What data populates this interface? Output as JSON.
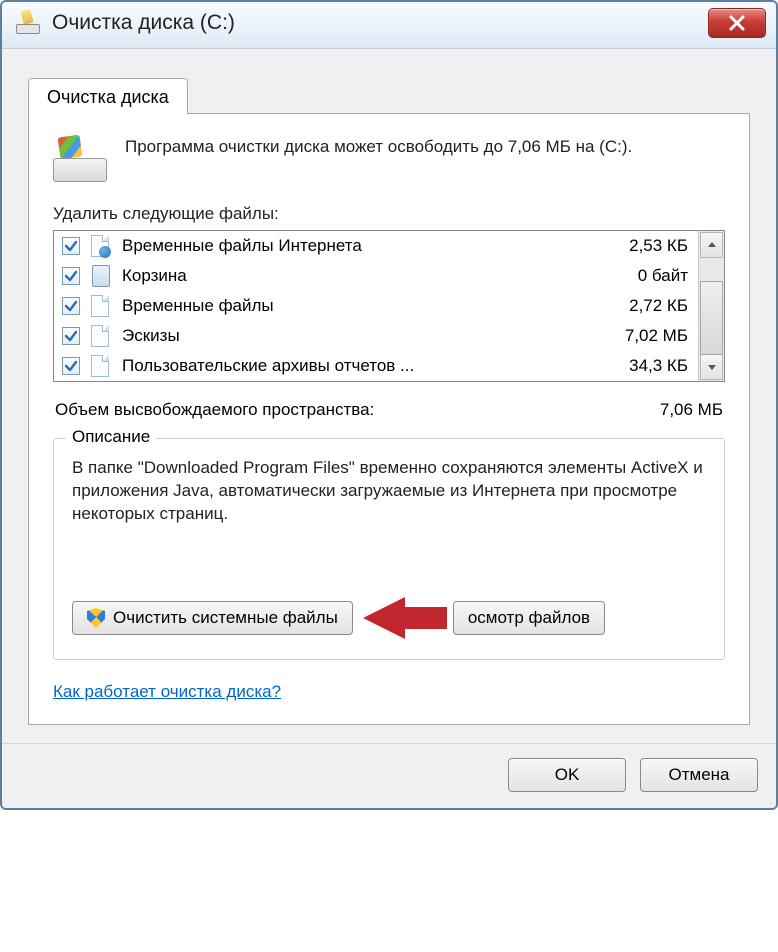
{
  "window": {
    "title": "Очистка диска  (C:)"
  },
  "tab": {
    "label": "Очистка диска"
  },
  "intro": {
    "text": "Программа очистки диска может освободить до 7,06 МБ на  (C:)."
  },
  "list": {
    "heading": "Удалить следующие файлы:",
    "items": [
      {
        "label": "Временные файлы Интернета",
        "size": "2,53 КБ",
        "checked": true,
        "icon": "ie-page"
      },
      {
        "label": "Корзина",
        "size": "0 байт",
        "checked": true,
        "icon": "bin"
      },
      {
        "label": "Временные файлы",
        "size": "2,72 КБ",
        "checked": true,
        "icon": "page"
      },
      {
        "label": "Эскизы",
        "size": "7,02 МБ",
        "checked": true,
        "icon": "page"
      },
      {
        "label": "Пользовательские архивы отчетов ...",
        "size": "34,3 КБ",
        "checked": true,
        "icon": "page"
      }
    ]
  },
  "total": {
    "label": "Объем высвобождаемого пространства:",
    "value": "7,06 МБ"
  },
  "description": {
    "group_title": "Описание",
    "text": "В папке \"Downloaded Program Files\" временно сохраняются элементы ActiveX и приложения Java, автоматически загружаемые из Интернета при просмотре некоторых страниц."
  },
  "buttons": {
    "clean_system": "Очистить системные файлы",
    "view_files": "осмотр файлов",
    "ok": "OK",
    "cancel": "Отмена"
  },
  "help": {
    "link": "Как работает очистка диска?"
  }
}
